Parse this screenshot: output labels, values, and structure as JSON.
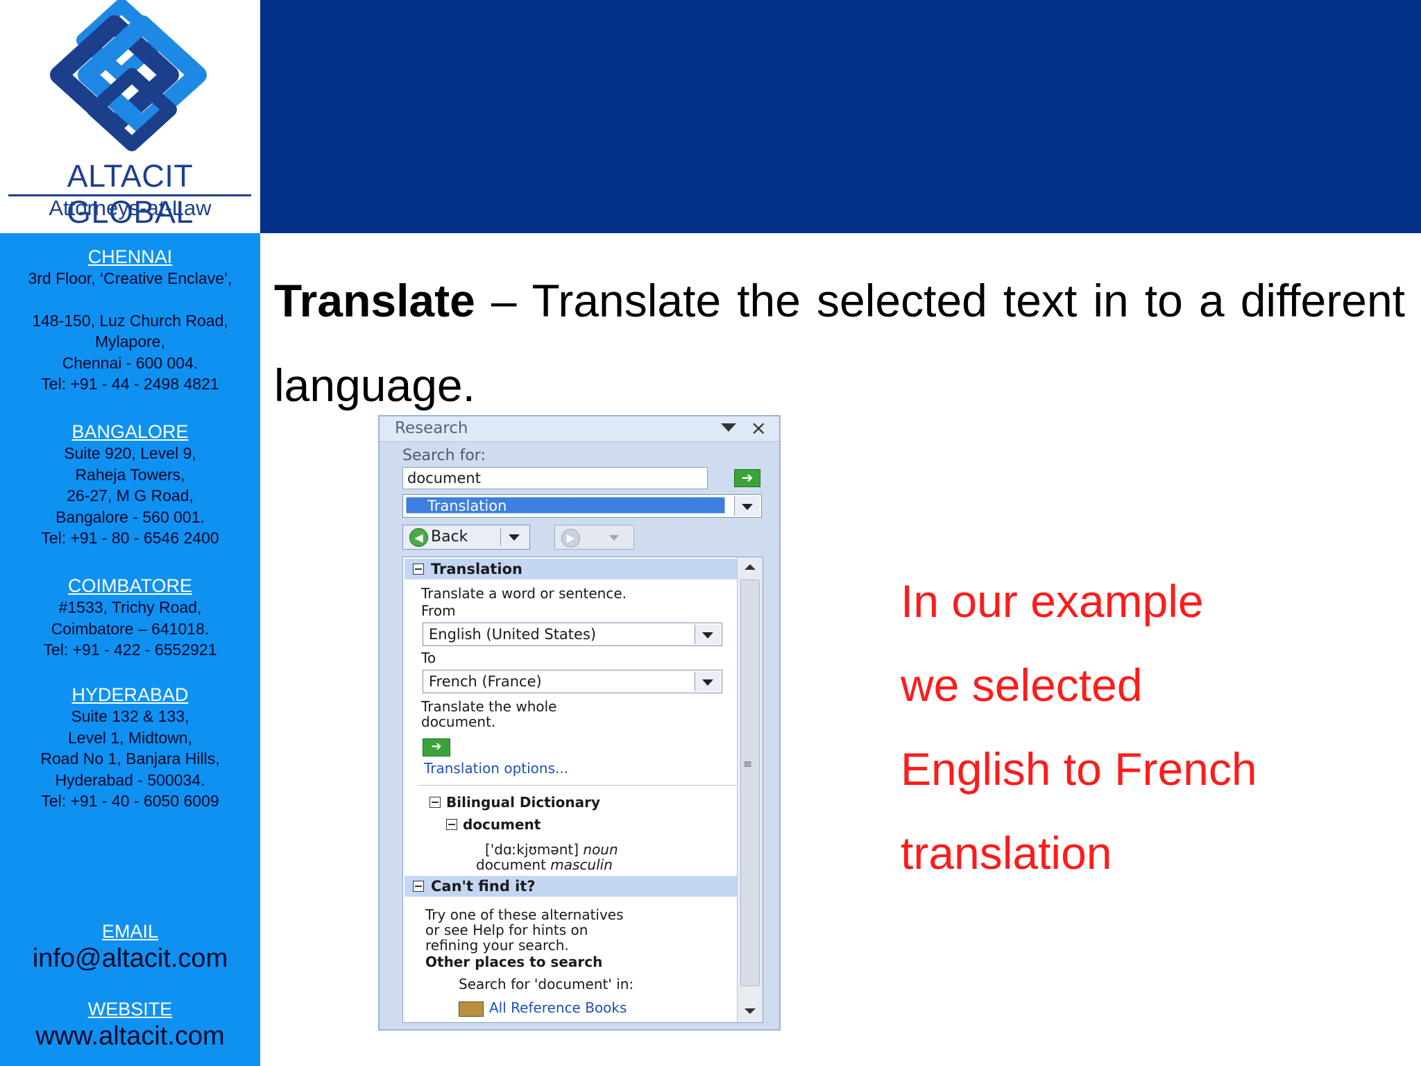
{
  "brand": {
    "name": "ALTACIT GLOBAL",
    "tagline": "Attorneys-at-Law"
  },
  "offices": [
    {
      "name": "CHENNAI",
      "lines": [
        "3rd Floor, ‘Creative Enclave’,",
        "",
        "148-150, Luz Church Road,",
        "Mylapore,",
        "Chennai - 600 004.",
        "Tel: +91 - 44 - 2498 4821"
      ]
    },
    {
      "name": "BANGALORE ",
      "lines": [
        "Suite 920, Level 9,",
        "Raheja Towers,",
        "26-27, M G Road,",
        "Bangalore - 560 001.",
        "Tel: +91 - 80 - 6546 2400"
      ]
    },
    {
      "name": "COIMBATORE",
      "lines": [
        "#1533, Trichy Road,",
        "Coimbatore – 641018.",
        "Tel: +91 - 422 - 6552921"
      ]
    },
    {
      "name": "HYDERABAD",
      "lines": [
        "Suite 132 & 133,",
        "Level 1, Midtown,",
        "Road No 1, Banjara Hills,",
        "Hyderabad - 500034.",
        "Tel: +91 - 40 - 6050 6009"
      ]
    }
  ],
  "contact": {
    "email_label": "EMAIL",
    "email": "info@altacit.com",
    "website_label": "WEBSITE",
    "website": "www.altacit.com"
  },
  "slide": {
    "heading_bold": "Translate",
    "heading_rest": " – Translate the selected text in to a different language.",
    "example_lines": [
      "In our example",
      "we selected",
      "English to French",
      "translation"
    ]
  },
  "research_pane": {
    "title": "Research",
    "close_glyph": "×",
    "search_for_label": "Search for:",
    "search_value": "document",
    "go_glyph": "➔",
    "service": "Translation",
    "back_label": "Back",
    "back_glyph": "◀",
    "forward_glyph": "▶",
    "translation_section": {
      "title": "Translation",
      "description": "Translate a word or sentence.",
      "from_label": "From",
      "from_value": "English (United States)",
      "to_label": "To",
      "to_value": "French (France)",
      "whole_doc_line1": "Translate the whole",
      "whole_doc_line2": "document.",
      "options_link": "Translation options..."
    },
    "dictionary": {
      "title": "Bilingual Dictionary",
      "word": "document",
      "pronunciation": "['dɑːkjʊmənt]",
      "pos": "noun",
      "translation": "document",
      "gender": "masculin"
    },
    "cant_find": {
      "title": "Can't find it?",
      "line1": "Try one of these alternatives",
      "line2": "or see Help for hints on",
      "line3": "refining your search.",
      "other_places": "Other places to search",
      "search_in": "Search for 'document' in:",
      "all_books": "All Reference Books"
    }
  },
  "colors": {
    "top_band": "#003087",
    "sidebar": "#0f91f2",
    "brand_text": "#1e3f8f",
    "example_text": "#ff1b1b"
  }
}
